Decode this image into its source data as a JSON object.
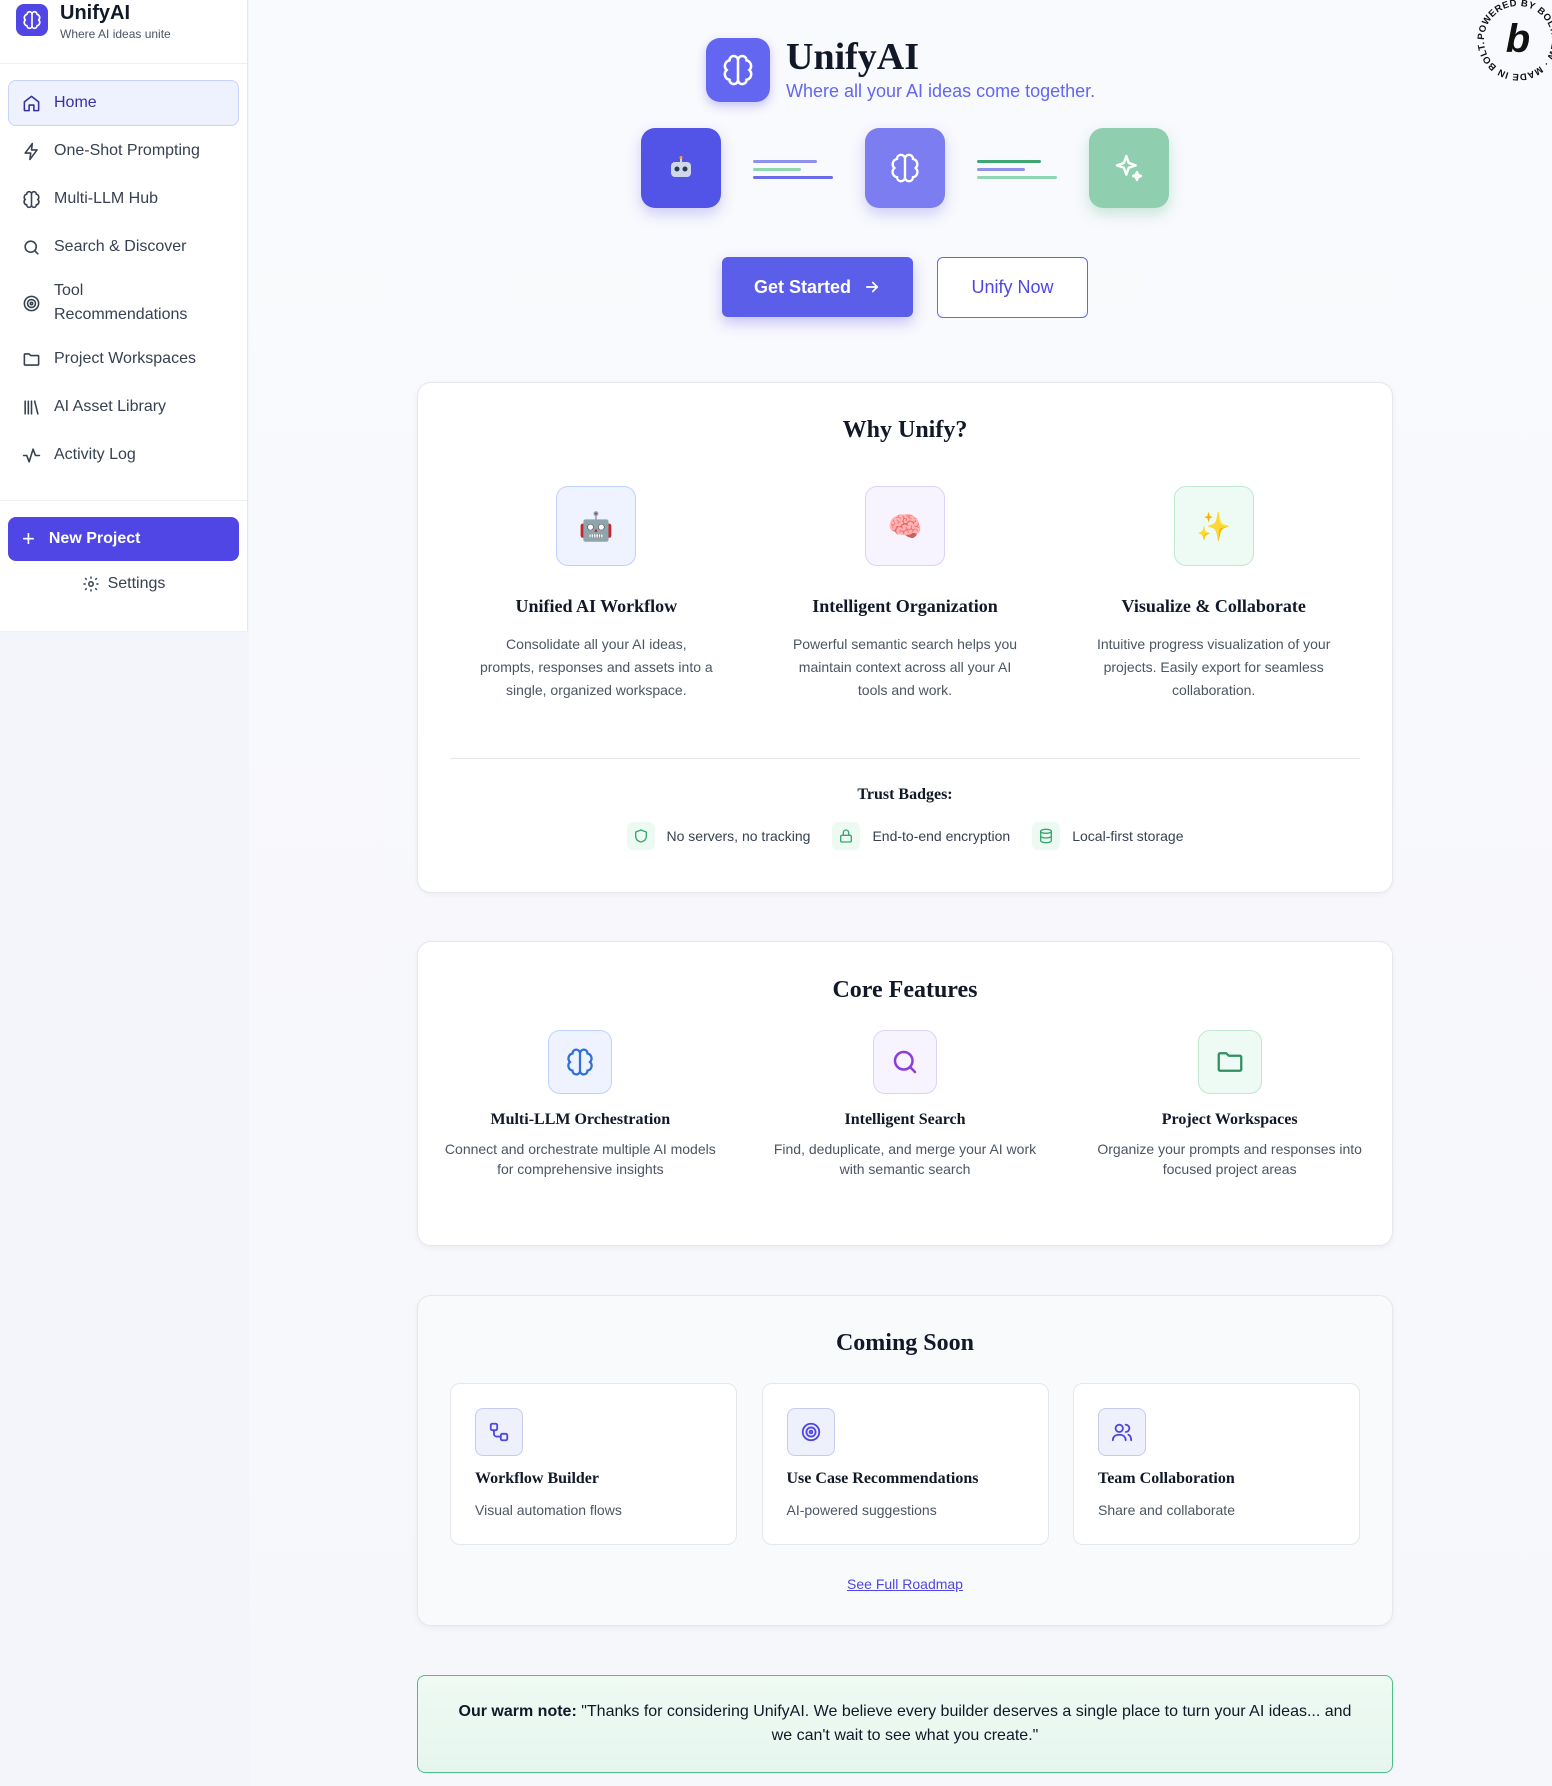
{
  "brand": {
    "title": "UnifyAI",
    "subtitle": "Where AI ideas unite"
  },
  "sidebar": {
    "items": [
      {
        "label": "Home",
        "icon": "home-icon"
      },
      {
        "label": "One-Shot Prompting",
        "icon": "lightning-icon"
      },
      {
        "label": "Multi-LLM Hub",
        "icon": "brain-icon"
      },
      {
        "label": "Search & Discover",
        "icon": "search-icon"
      },
      {
        "label": "Tool Recommendations",
        "icon": "target-icon"
      },
      {
        "label": "Project Workspaces",
        "icon": "folder-icon"
      },
      {
        "label": "AI Asset Library",
        "icon": "library-icon"
      },
      {
        "label": "Activity Log",
        "icon": "activity-icon"
      }
    ],
    "new_project": "New Project",
    "settings": "Settings"
  },
  "hero": {
    "title": "UnifyAI",
    "subtitle": "Where all your AI ideas come together.",
    "get_started": "Get Started",
    "unify_now": "Unify Now"
  },
  "why": {
    "title": "Why Unify?",
    "features": [
      {
        "emoji": "🤖",
        "title": "Unified AI Workflow",
        "desc": "Consolidate all your AI ideas, prompts, responses and assets into a single, organized workspace."
      },
      {
        "emoji": "🧠",
        "title": "Intelligent Organization",
        "desc": "Powerful semantic search helps you maintain context across all your AI tools and work."
      },
      {
        "emoji": "✨",
        "title": "Visualize & Collaborate",
        "desc": "Intuitive progress visualization of your projects. Easily export for seamless collaboration."
      }
    ],
    "trust_title": "Trust Badges:",
    "badges": [
      {
        "label": "No servers, no tracking",
        "icon": "shield-icon"
      },
      {
        "label": "End-to-end encryption",
        "icon": "lock-icon"
      },
      {
        "label": "Local-first storage",
        "icon": "database-icon"
      }
    ]
  },
  "core": {
    "title": "Core Features",
    "features": [
      {
        "title": "Multi-LLM Orchestration",
        "desc": "Connect and orchestrate multiple AI models for comprehensive insights",
        "icon": "brain-icon"
      },
      {
        "title": "Intelligent Search",
        "desc": "Find, deduplicate, and merge your AI work with semantic search",
        "icon": "search-icon"
      },
      {
        "title": "Project Workspaces",
        "desc": "Organize your prompts and responses into focused project areas",
        "icon": "folder-icon"
      }
    ]
  },
  "soon": {
    "title": "Coming Soon",
    "items": [
      {
        "title": "Workflow Builder",
        "desc": "Visual automation flows",
        "icon": "workflow-icon"
      },
      {
        "title": "Use Case Recommendations",
        "desc": "AI-powered suggestions",
        "icon": "target-icon"
      },
      {
        "title": "Team Collaboration",
        "desc": "Share and collaborate",
        "icon": "users-icon"
      }
    ],
    "roadmap": "See Full Roadmap"
  },
  "note": {
    "label": "Our warm note:",
    "text": "\"Thanks for considering UnifyAI. We believe every builder deserves a single place to turn your AI ideas... and we can't wait to see what you create.\""
  },
  "bolt_badge": {
    "text": "POWERED BY BOLT.NEW · MADE IN BOLT.NEW · ",
    "letter": "b"
  },
  "colors": {
    "accent": "#4f46e5",
    "green": "#34a86e"
  }
}
